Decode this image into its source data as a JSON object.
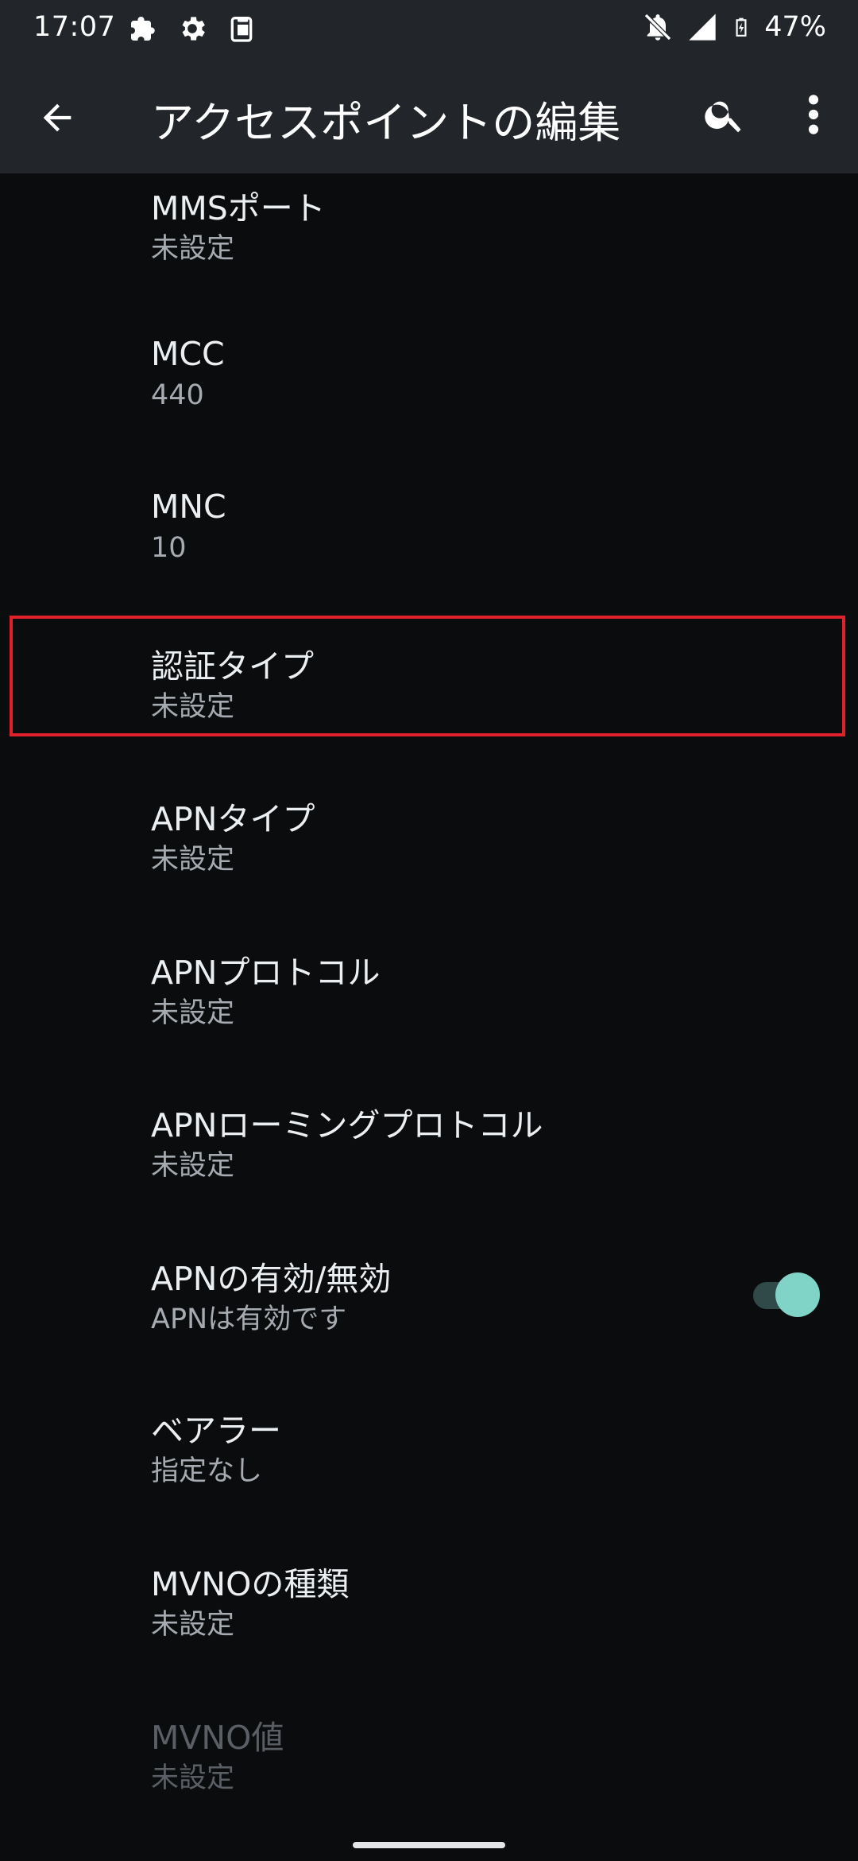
{
  "status_bar": {
    "time": "17:07",
    "left_icons": [
      "puzzle-icon",
      "gear-icon",
      "clipboard-icon"
    ],
    "right_icons": [
      "notifications-off-icon",
      "signal-icon",
      "battery-charging-icon"
    ],
    "battery": "47%"
  },
  "app_bar": {
    "title": "アクセスポイントの編集",
    "icons": [
      "back-arrow-icon",
      "search-icon",
      "more-vert-icon"
    ]
  },
  "preferences": [
    {
      "id": "mms-port",
      "title": "MMSポート",
      "summary": "未設定"
    },
    {
      "id": "mcc",
      "title": "MCC",
      "summary": "440"
    },
    {
      "id": "mnc",
      "title": "MNC",
      "summary": "10"
    },
    {
      "id": "auth-type",
      "title": "認証タイプ",
      "summary": "未設定"
    },
    {
      "id": "apn-type",
      "title": "APNタイプ",
      "summary": "未設定"
    },
    {
      "id": "apn-protocol",
      "title": "APNプロトコル",
      "summary": "未設定"
    },
    {
      "id": "apn-roaming-protocol",
      "title": "APNローミングプロトコル",
      "summary": "未設定"
    },
    {
      "id": "apn-enable",
      "title": "APNの有効/無効",
      "summary": "APNは有効です",
      "toggle_on": true
    },
    {
      "id": "bearer",
      "title": "ベアラー",
      "summary": "指定なし"
    },
    {
      "id": "mvno-type",
      "title": "MVNOの種類",
      "summary": "未設定"
    },
    {
      "id": "mvno-value",
      "title": "MVNO値",
      "summary": "未設定",
      "disabled": true
    }
  ],
  "colors": {
    "app_bar_bg": "#22262b",
    "background": "#0b0c0e",
    "highlight": "#e0202a",
    "toggle_thumb": "#7fd3c7",
    "toggle_track": "#2f4a48"
  }
}
